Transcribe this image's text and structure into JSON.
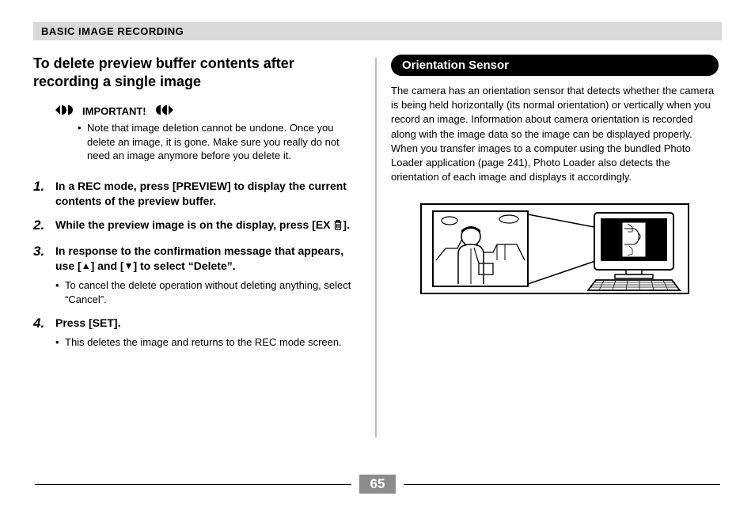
{
  "header": {
    "title": "BASIC IMAGE RECORDING"
  },
  "left": {
    "title": "To delete preview buffer contents after recording a single image",
    "important_label": "IMPORTANT!",
    "important_bullets": [
      "Note that image deletion cannot be undone. Once you delete an image, it is gone. Make sure you really do not need an image anymore before you delete it."
    ],
    "steps": [
      {
        "num": "1.",
        "text": "In a REC mode, press [PREVIEW] to display the current contents of the preview buffer.",
        "subs": []
      },
      {
        "num": "2.",
        "text_pre": "While the preview image is on the display, press [EX ",
        "text_post": "].",
        "subs": []
      },
      {
        "num": "3.",
        "text_pre": "In response to the confirmation message that appears, use [",
        "text_mid": "] and [",
        "text_post": "] to select “Delete”.",
        "subs": [
          "To cancel the delete operation without deleting anything, select “Cancel”."
        ]
      },
      {
        "num": "4.",
        "text": "Press [SET].",
        "subs": [
          "This deletes the image and returns to the REC mode screen."
        ]
      }
    ]
  },
  "right": {
    "section_title": "Orientation Sensor",
    "body": "The camera has an orientation sensor that detects whether the camera is being held horizontally (its normal orientation) or vertically when you record an image. Information about camera orientation is recorded along with the image data so the image can be displayed properly. When you transfer images to a computer using the bundled Photo Loader application (page 241), Photo Loader also detects the orientation of each image and displays it accordingly."
  },
  "page_number": "65"
}
